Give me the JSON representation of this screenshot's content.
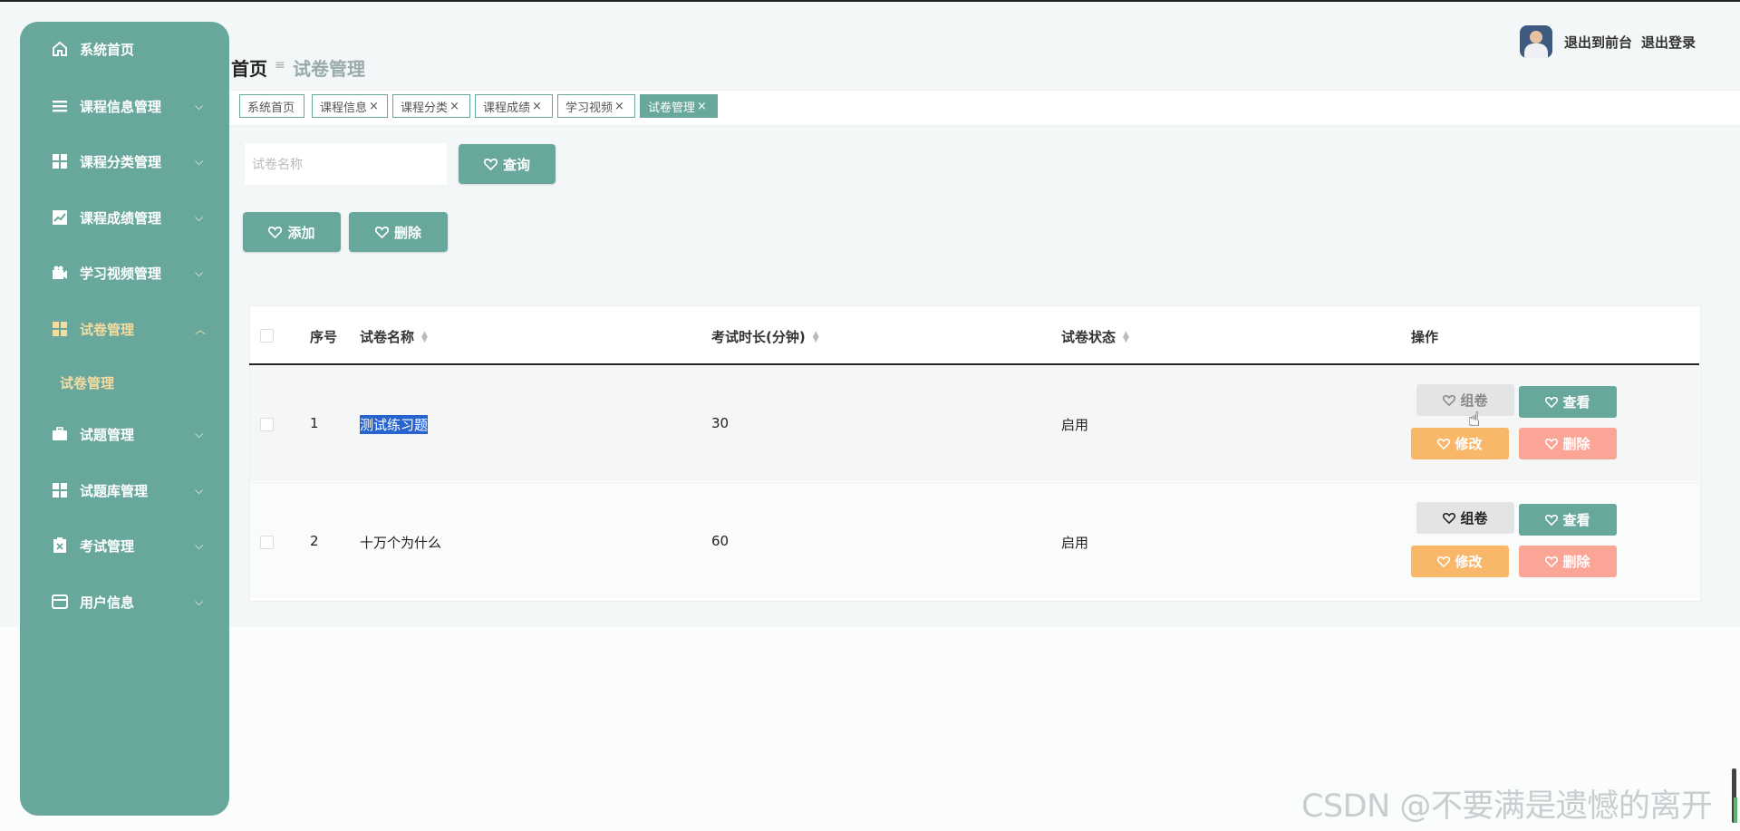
{
  "sidebar": {
    "items": [
      {
        "label": "系统首页",
        "icon": "home-icon"
      },
      {
        "label": "课程信息管理",
        "icon": "list-icon"
      },
      {
        "label": "课程分类管理",
        "icon": "grid-icon"
      },
      {
        "label": "课程成绩管理",
        "icon": "chart-icon"
      },
      {
        "label": "学习视频管理",
        "icon": "video-icon"
      },
      {
        "label": "试卷管理",
        "icon": "grid-icon"
      },
      {
        "label": "试题管理",
        "icon": "briefcase-icon"
      },
      {
        "label": "试题库管理",
        "icon": "grid-icon"
      },
      {
        "label": "考试管理",
        "icon": "clipboard-icon"
      },
      {
        "label": "用户信息",
        "icon": "card-icon"
      }
    ],
    "sub_item": "试卷管理"
  },
  "breadcrumb": {
    "home": "首页",
    "separator": "≡",
    "current": "试卷管理"
  },
  "header": {
    "back_front": "退出到前台",
    "logout": "退出登录"
  },
  "tabs": [
    {
      "label": "系统首页",
      "close": ""
    },
    {
      "label": "课程信息",
      "close": "×"
    },
    {
      "label": "课程分类",
      "close": "×"
    },
    {
      "label": "课程成绩",
      "close": "×"
    },
    {
      "label": "学习视频",
      "close": "×"
    },
    {
      "label": "试卷管理",
      "close": "×"
    }
  ],
  "search": {
    "placeholder": "试卷名称",
    "button": "查询"
  },
  "toolbar": {
    "add": "添加",
    "delete": "删除"
  },
  "table": {
    "headers": [
      "序号",
      "试卷名称",
      "考试时长(分钟)",
      "试卷状态",
      "操作"
    ],
    "rows": [
      {
        "index": "1",
        "name": "测试练习题",
        "duration": "30",
        "status": "启用"
      },
      {
        "index": "2",
        "name": "十万个为什么",
        "duration": "60",
        "status": "启用"
      }
    ],
    "actions": {
      "compose": "组卷",
      "view": "查看",
      "edit": "修改",
      "delete": "删除"
    }
  },
  "watermark": "CSDN @不要满是遗憾的离开",
  "colors": {
    "primary": "#68a89c",
    "active_text": "#f6dba0",
    "orange": "#f9b76a",
    "pink": "#fba597"
  }
}
